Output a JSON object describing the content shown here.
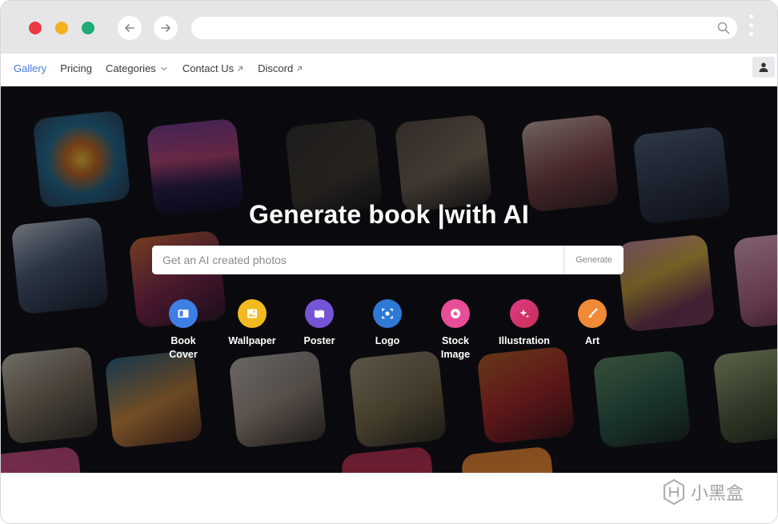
{
  "browser": {
    "url": ""
  },
  "nav": {
    "links": [
      {
        "label": "Gallery",
        "active": true
      },
      {
        "label": "Pricing"
      },
      {
        "label": "Categories",
        "dropdown": true
      },
      {
        "label": "Contact Us",
        "external": true
      },
      {
        "label": "Discord",
        "external": true
      }
    ]
  },
  "hero": {
    "headline": "Generate book |with AI",
    "search_placeholder": "Get an AI created photos",
    "generate_label": "Generate"
  },
  "categories": [
    {
      "label": "Book Cover",
      "icon": "book-icon",
      "color": "#3e7fe6"
    },
    {
      "label": "Wallpaper",
      "icon": "image-icon",
      "color": "#f2b920"
    },
    {
      "label": "Poster",
      "icon": "poster-icon",
      "color": "#7654d6"
    },
    {
      "label": "Logo",
      "icon": "logo-scan-icon",
      "color": "#2e78d6"
    },
    {
      "label": "Stock Image",
      "icon": "star-icon",
      "color": "#e84e97"
    },
    {
      "label": "Illustration",
      "icon": "sparkle-icon",
      "color": "#d93a74"
    },
    {
      "label": "Art",
      "icon": "brush-icon",
      "color": "#f08a36"
    }
  ],
  "watermark": {
    "text": "小黑盒"
  }
}
